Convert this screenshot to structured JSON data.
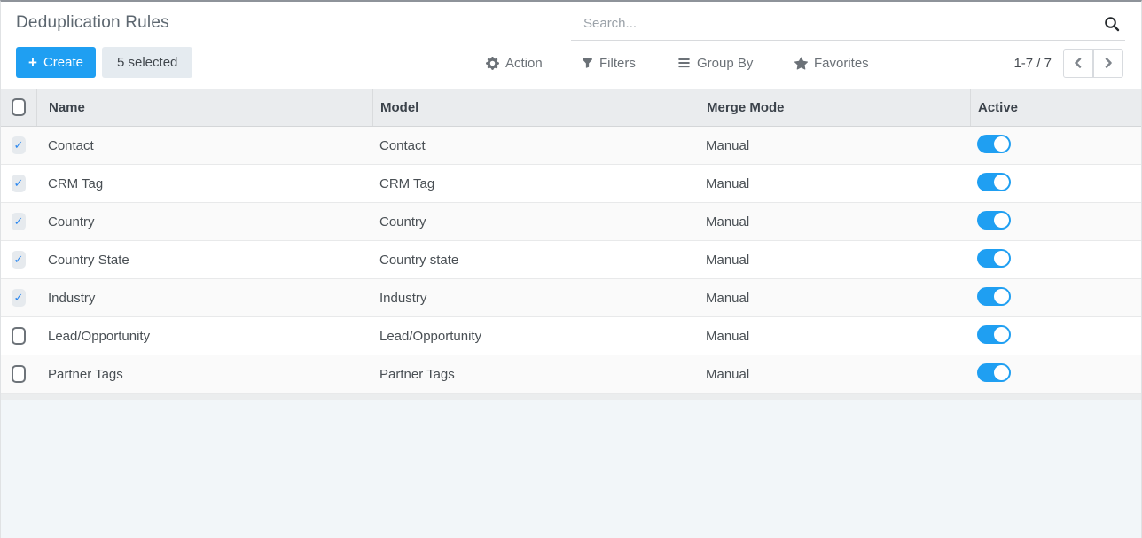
{
  "header": {
    "title": "Deduplication Rules"
  },
  "search": {
    "placeholder": "Search..."
  },
  "toolbar": {
    "create_label": "Create",
    "selected_label": "5 selected",
    "menus": [
      {
        "label": "Action",
        "icon": "gear-icon"
      },
      {
        "label": "Filters",
        "icon": "filter-icon"
      },
      {
        "label": "Group By",
        "icon": "group-by-icon"
      },
      {
        "label": "Favorites",
        "icon": "star-icon"
      }
    ],
    "pager": {
      "range": "1-7 / 7"
    }
  },
  "table": {
    "columns": [
      "Name",
      "Model",
      "Merge Mode",
      "Active"
    ],
    "rows": [
      {
        "name": "Contact",
        "model": "Contact",
        "merge_mode": "Manual",
        "active": true,
        "selected": true
      },
      {
        "name": "CRM Tag",
        "model": "CRM Tag",
        "merge_mode": "Manual",
        "active": true,
        "selected": true
      },
      {
        "name": "Country",
        "model": "Country",
        "merge_mode": "Manual",
        "active": true,
        "selected": true
      },
      {
        "name": "Country State",
        "model": "Country state",
        "merge_mode": "Manual",
        "active": true,
        "selected": true
      },
      {
        "name": "Industry",
        "model": "Industry",
        "merge_mode": "Manual",
        "active": true,
        "selected": true
      },
      {
        "name": "Lead/Opportunity",
        "model": "Lead/Opportunity",
        "merge_mode": "Manual",
        "active": true,
        "selected": false
      },
      {
        "name": "Partner Tags",
        "model": "Partner Tags",
        "merge_mode": "Manual",
        "active": true,
        "selected": false
      }
    ]
  },
  "icons": {
    "plus": "+",
    "check": "✓"
  },
  "colors": {
    "accent": "#1f9ff2",
    "badge_bg": "#e5ebf0",
    "header_bg": "#eaecee",
    "row_alt_bg": "#fafafa",
    "strip_bg": "#ebedee",
    "bottom_bg": "#f2f6f9",
    "text_muted": "#6b7177",
    "check_blue": "#2d88ef"
  }
}
